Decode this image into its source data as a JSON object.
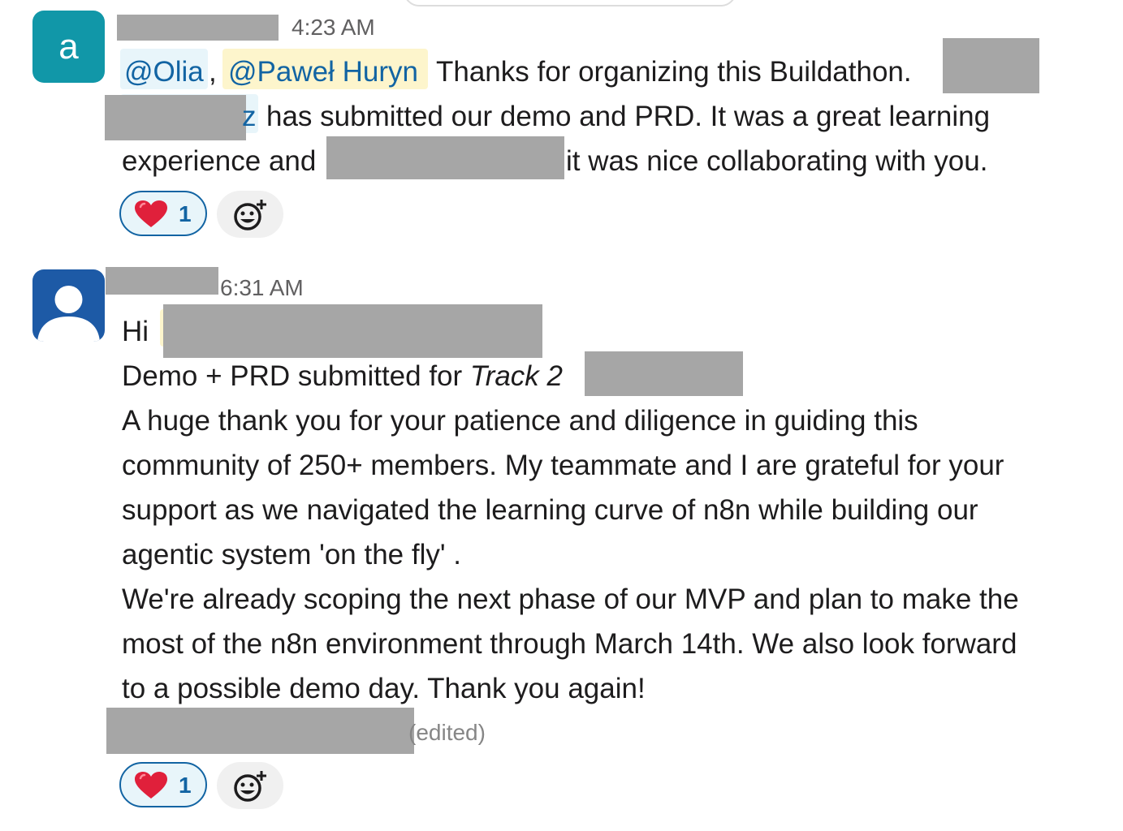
{
  "messages": [
    {
      "avatar_letter": "a",
      "timestamp": "4:23 AM",
      "mention_olia": "@Olia",
      "comma": ",",
      "mention_pawel": "@Paweł Huryn",
      "text_line1": "Thanks for organizing this Buildathon.",
      "mention_fragment": "z",
      "text_line2": "has submitted our demo and PRD. It was a great learning",
      "text_line3a": "experience and",
      "text_line3b": "it was nice collaborating with you.",
      "reaction_count": "1"
    },
    {
      "timestamp": "6:31 AM",
      "line_hi": "Hi",
      "line_demo_prefix": "Demo + PRD submitted for ",
      "line_demo_track": "Track 2",
      "lines": [
        "A huge thank you for your patience and diligence in guiding this",
        "community of 250+ members. My teammate and I are grateful for your",
        "support as we navigated the learning curve of n8n while building our",
        "agentic system 'on the fly' .",
        "We're already scoping the next phase of our MVP and plan to make the",
        "most of the n8n environment through March 14th. We also look forward",
        "to a possible demo day. Thank you again!"
      ],
      "edited_label": "(edited)",
      "reaction_count": "1"
    }
  ],
  "colors": {
    "mention_text": "#1264a3",
    "mention_bg": "#e8f5fa",
    "mention_self_bg": "#fdf5cc",
    "avatar_teal": "#1197a8",
    "avatar_blue": "#1d5aa6",
    "redaction": "#a6a6a6"
  },
  "icons": {
    "reaction": "red-heart-icon",
    "add_reaction": "add-emoji-icon",
    "default_avatar": "person-silhouette-icon"
  }
}
